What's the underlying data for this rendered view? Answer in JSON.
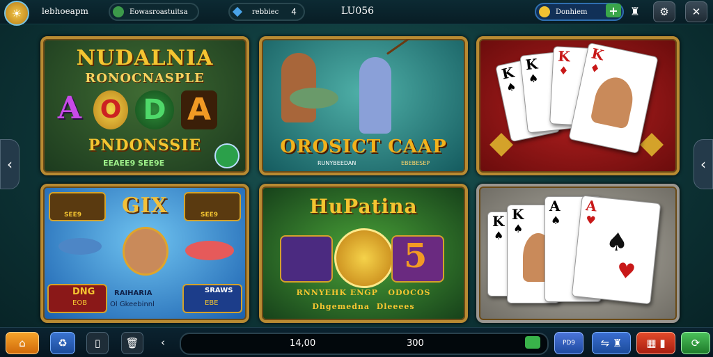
{
  "topbar": {
    "profile_name": "lebhoeapm",
    "center_pill_label": "Eowasroastuitsa",
    "level_label": "rebbiec",
    "level_value": "4",
    "title": "LU056",
    "balance_label": "Donhiem",
    "add_icon": "plus-icon",
    "icons": [
      "shield-gift-icon",
      "settings-icon",
      "close-icon"
    ]
  },
  "tiles": [
    {
      "title_line1": "NUDALNIA",
      "title_line2": "RONOCNASPLE",
      "letters": [
        "A",
        "O",
        "D",
        "A"
      ],
      "subtitle": "PNDONSSIE",
      "footer": "EEAEE9 SEE9E",
      "colors": {
        "bg": "#2b4a2a",
        "title": "#f4c531"
      }
    },
    {
      "title": "OROSICT CAAP",
      "subtitle": "RUNYBEEDAN",
      "subtitle2": "EBEBESEP",
      "colors": {
        "bg": "#1b6a6e",
        "title": "#f2b21c"
      }
    },
    {
      "ranks": [
        "K",
        "K",
        "K",
        "K"
      ],
      "colors": {
        "bg": "#8c1414"
      }
    },
    {
      "title": "GIX",
      "badge_left": "SEE9",
      "badge_right": "SEE9",
      "bottom_left_top": "DNG",
      "bottom_left_bottom": "EOB",
      "bottom_center_line1": "RAIHARIA",
      "bottom_center_line2": "Ol Gkeebinnl",
      "bottom_right_top": "SRAWS",
      "bottom_right_bottom": "EBE",
      "colors": {
        "bg": "#1d5fae",
        "title": "#f3c13a"
      }
    },
    {
      "title": "HuPatina",
      "big_value": "5",
      "line1": "RNNYEHK ENGP   ODOCOS",
      "line2": "Dhgemedna  Dleeees",
      "colors": {
        "bg": "#1f5a26",
        "title": "#f4c531"
      }
    },
    {
      "ranks": [
        "K",
        "K",
        "A",
        "A"
      ],
      "colors": {
        "bg": "#8a877f"
      }
    }
  ],
  "bottombar": {
    "left_value": "14,00",
    "right_value": "300",
    "small_label": "PD9",
    "icons": [
      "home-icon",
      "recycle-icon",
      "cards-icon",
      "trash-icon",
      "back-icon",
      "shield-icon",
      "controller-icon",
      "menu-icon",
      "refresh-icon"
    ]
  },
  "side_arrows": {
    "left": "‹",
    "right": "‹"
  }
}
